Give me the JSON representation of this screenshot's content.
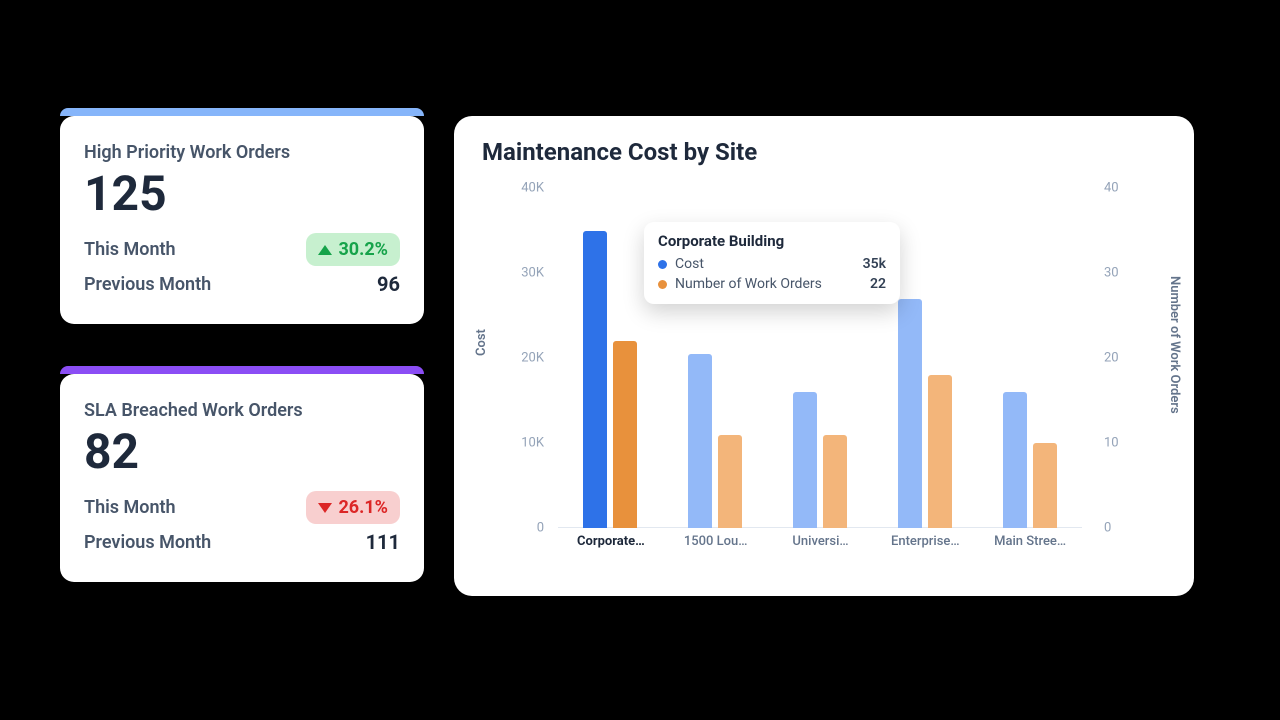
{
  "cards": [
    {
      "accent": "#86B5FA",
      "title": "High Priority Work Orders",
      "value": "125",
      "this_label": "This Month",
      "delta": "30.2%",
      "dir": "up",
      "prev_label": "Previous Month",
      "prev_val": "96"
    },
    {
      "accent": "#8B4DF5",
      "title": "SLA Breached Work Orders",
      "value": "82",
      "this_label": "This Month",
      "delta": "26.1%",
      "dir": "down",
      "prev_label": "Previous Month",
      "prev_val": "111"
    }
  ],
  "chart": {
    "title": "Maintenance Cost by Site",
    "y_left_label": "Cost",
    "y_right_label": "Number of Work Orders",
    "y_left_ticks": [
      "0",
      "10K",
      "20K",
      "30K",
      "40K"
    ],
    "y_right_ticks": [
      "0",
      "10",
      "20",
      "30",
      "40"
    ],
    "tooltip": {
      "site": "Corporate Building",
      "rows": [
        {
          "label": "Cost",
          "color": "#2E72E8",
          "value": "35k"
        },
        {
          "label": "Number of Work Orders",
          "color": "#E8913C",
          "value": "22"
        }
      ]
    }
  },
  "chart_data": {
    "type": "bar",
    "title": "Maintenance Cost by Site",
    "categories": [
      "Corporate…",
      "1500 Lou…",
      "Universi…",
      "Enterprise…",
      "Main Stree…"
    ],
    "categories_full": [
      "Corporate Building",
      "1500 Lou…",
      "Universi…",
      "Enterprise…",
      "Main Stree…"
    ],
    "series": [
      {
        "name": "Cost",
        "axis": "left",
        "color": "#2E72E8",
        "values": [
          35000,
          20500,
          16000,
          27000,
          16000
        ]
      },
      {
        "name": "Number of Work Orders",
        "axis": "right",
        "color": "#E8913C",
        "values": [
          22,
          11,
          11,
          18,
          10
        ]
      }
    ],
    "y_left": {
      "label": "Cost",
      "lim": [
        0,
        40000
      ]
    },
    "y_right": {
      "label": "Number of Work Orders",
      "lim": [
        0,
        40
      ]
    },
    "highlight_index": 0
  }
}
